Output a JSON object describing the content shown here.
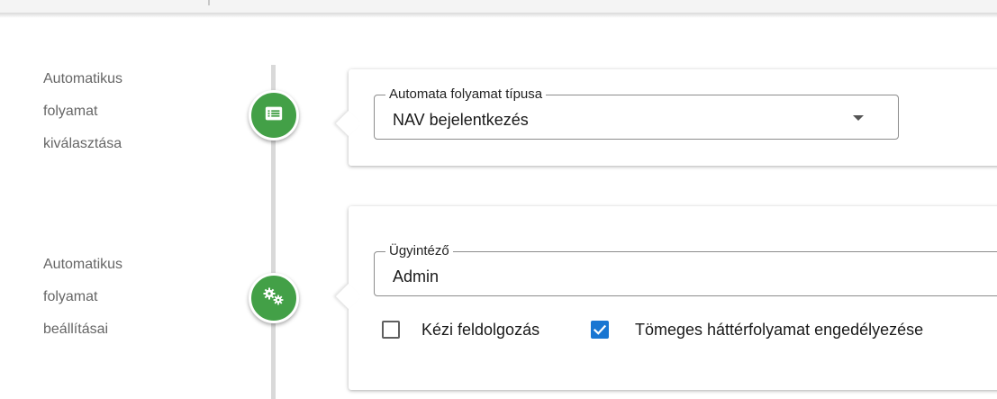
{
  "steps": [
    {
      "label": "Automatikus\nfolyamat\nkiválasztása",
      "icon": "list-icon",
      "field": {
        "legend": "Automata folyamat típusa",
        "value": "NAV bejelentkezés"
      }
    },
    {
      "label": "Automatikus\nfolyamat\nbeállításai",
      "icon": "gears-icon",
      "field": {
        "legend": "Ügyintéző",
        "value": "Admin"
      },
      "checkboxes": [
        {
          "label": "Kézi feldolgozás",
          "checked": false
        },
        {
          "label": "Tömeges háttérfolyamat engedélyezése",
          "checked": true
        }
      ]
    }
  ],
  "colors": {
    "step_green": "#43a047",
    "checkbox_blue": "#1976d2"
  }
}
